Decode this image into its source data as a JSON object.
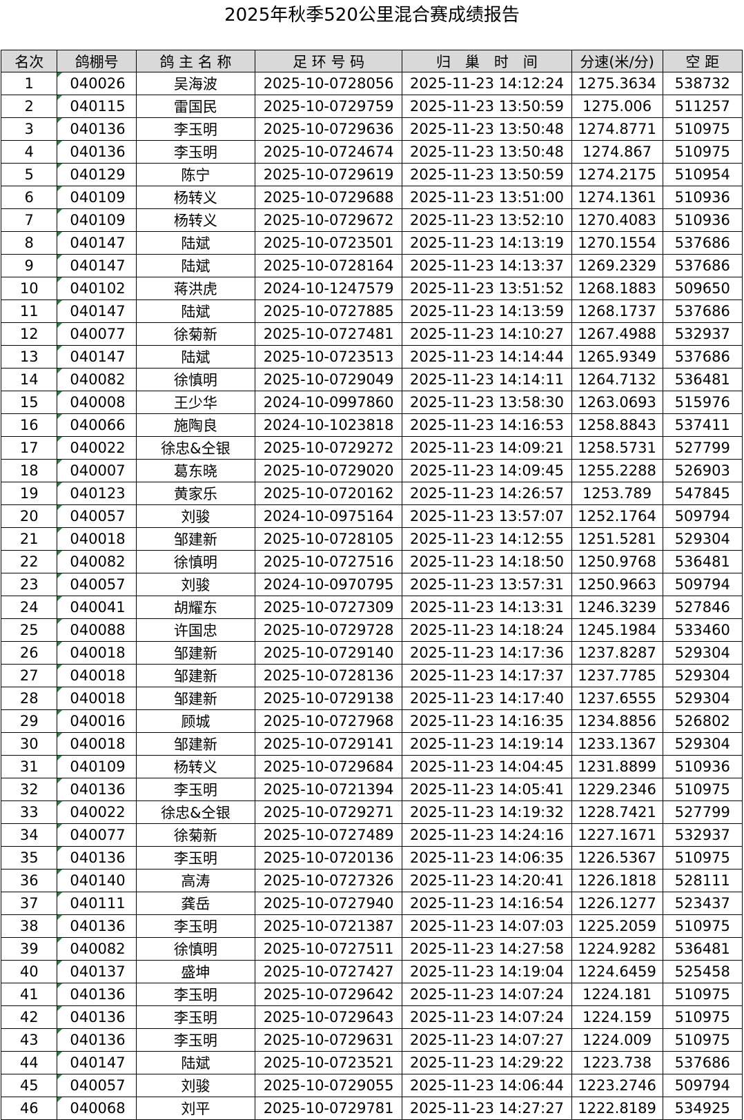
{
  "title": "2025年秋季520公里混合赛成绩报告",
  "columns": [
    "名次",
    "鸽棚号",
    "鸽 主 名 称",
    "足 环 号 码",
    "归　巢　时　间",
    "分速(米/分)",
    "空 距"
  ],
  "rows": [
    [
      "1",
      "040026",
      "吴海波",
      "2025-10-0728056",
      "2025-11-23 14:12:24",
      "1275.3634",
      "538732"
    ],
    [
      "2",
      "040115",
      "雷国民",
      "2025-10-0729759",
      "2025-11-23 13:50:59",
      "1275.006",
      "511257"
    ],
    [
      "3",
      "040136",
      "李玉明",
      "2025-10-0729636",
      "2025-11-23 13:50:48",
      "1274.8771",
      "510975"
    ],
    [
      "4",
      "040136",
      "李玉明",
      "2025-10-0724674",
      "2025-11-23 13:50:48",
      "1274.867",
      "510975"
    ],
    [
      "5",
      "040129",
      "陈宁",
      "2025-10-0729619",
      "2025-11-23 13:50:59",
      "1274.2175",
      "510954"
    ],
    [
      "6",
      "040109",
      "杨转义",
      "2025-10-0729688",
      "2025-11-23 13:51:00",
      "1274.1361",
      "510936"
    ],
    [
      "7",
      "040109",
      "杨转义",
      "2025-10-0729672",
      "2025-11-23 13:52:10",
      "1270.4083",
      "510936"
    ],
    [
      "8",
      "040147",
      "陆斌",
      "2025-10-0723501",
      "2025-11-23 14:13:19",
      "1270.1554",
      "537686"
    ],
    [
      "9",
      "040147",
      "陆斌",
      "2025-10-0728164",
      "2025-11-23 14:13:37",
      "1269.2329",
      "537686"
    ],
    [
      "10",
      "040102",
      "蒋洪虎",
      "2024-10-1247579",
      "2025-11-23 13:51:52",
      "1268.1883",
      "509650"
    ],
    [
      "11",
      "040147",
      "陆斌",
      "2025-10-0727885",
      "2025-11-23 14:13:59",
      "1268.1737",
      "537686"
    ],
    [
      "12",
      "040077",
      "徐菊新",
      "2025-10-0727481",
      "2025-11-23 14:10:27",
      "1267.4988",
      "532937"
    ],
    [
      "13",
      "040147",
      "陆斌",
      "2025-10-0723513",
      "2025-11-23 14:14:44",
      "1265.9349",
      "537686"
    ],
    [
      "14",
      "040082",
      "徐慎明",
      "2025-10-0729049",
      "2025-11-23 14:14:11",
      "1264.7132",
      "536481"
    ],
    [
      "15",
      "040008",
      "王少华",
      "2024-10-0997860",
      "2025-11-23 13:58:30",
      "1263.0693",
      "515976"
    ],
    [
      "16",
      "040066",
      "施陶良",
      "2024-10-1023818",
      "2025-11-23 14:16:53",
      "1258.8843",
      "537411"
    ],
    [
      "17",
      "040022",
      "徐忠&仝银",
      "2025-10-0729272",
      "2025-11-23 14:09:21",
      "1258.5731",
      "527799"
    ],
    [
      "18",
      "040007",
      "葛东晓",
      "2025-10-0729020",
      "2025-11-23 14:09:45",
      "1255.2288",
      "526903"
    ],
    [
      "19",
      "040123",
      "黄家乐",
      "2025-10-0720162",
      "2025-11-23 14:26:57",
      "1253.789",
      "547845"
    ],
    [
      "20",
      "040057",
      "刘骏",
      "2024-10-0975164",
      "2025-11-23 13:57:07",
      "1252.1764",
      "509794"
    ],
    [
      "21",
      "040018",
      "邹建新",
      "2025-10-0728105",
      "2025-11-23 14:12:55",
      "1251.5281",
      "529304"
    ],
    [
      "22",
      "040082",
      "徐慎明",
      "2025-10-0727516",
      "2025-11-23 14:18:50",
      "1250.9768",
      "536481"
    ],
    [
      "23",
      "040057",
      "刘骏",
      "2024-10-0970795",
      "2025-11-23 13:57:31",
      "1250.9663",
      "509794"
    ],
    [
      "24",
      "040041",
      "胡耀东",
      "2025-10-0727309",
      "2025-11-23 14:13:31",
      "1246.3239",
      "527846"
    ],
    [
      "25",
      "040088",
      "许国忠",
      "2025-10-0729728",
      "2025-11-23 14:18:24",
      "1245.1984",
      "533460"
    ],
    [
      "26",
      "040018",
      "邹建新",
      "2025-10-0729140",
      "2025-11-23 14:17:36",
      "1237.8287",
      "529304"
    ],
    [
      "27",
      "040018",
      "邹建新",
      "2025-10-0728136",
      "2025-11-23 14:17:37",
      "1237.7785",
      "529304"
    ],
    [
      "28",
      "040018",
      "邹建新",
      "2025-10-0729138",
      "2025-11-23 14:17:40",
      "1237.6555",
      "529304"
    ],
    [
      "29",
      "040016",
      "顾城",
      "2025-10-0727968",
      "2025-11-23 14:16:35",
      "1234.8856",
      "526802"
    ],
    [
      "30",
      "040018",
      "邹建新",
      "2025-10-0729141",
      "2025-11-23 14:19:14",
      "1233.1367",
      "529304"
    ],
    [
      "31",
      "040109",
      "杨转义",
      "2025-10-0729684",
      "2025-11-23 14:04:45",
      "1231.8899",
      "510936"
    ],
    [
      "32",
      "040136",
      "李玉明",
      "2025-10-0721394",
      "2025-11-23 14:05:41",
      "1229.2346",
      "510975"
    ],
    [
      "33",
      "040022",
      "徐忠&仝银",
      "2025-10-0729271",
      "2025-11-23 14:19:32",
      "1228.7421",
      "527799"
    ],
    [
      "34",
      "040077",
      "徐菊新",
      "2025-10-0727489",
      "2025-11-23 14:24:16",
      "1227.1671",
      "532937"
    ],
    [
      "35",
      "040136",
      "李玉明",
      "2025-10-0720136",
      "2025-11-23 14:06:35",
      "1226.5367",
      "510975"
    ],
    [
      "36",
      "040140",
      "高涛",
      "2025-10-0727326",
      "2025-11-23 14:20:41",
      "1226.1818",
      "528111"
    ],
    [
      "37",
      "040111",
      "龚岳",
      "2025-10-0727940",
      "2025-11-23 14:16:54",
      "1226.1277",
      "523437"
    ],
    [
      "38",
      "040136",
      "李玉明",
      "2025-10-0721387",
      "2025-11-23 14:07:03",
      "1225.2059",
      "510975"
    ],
    [
      "39",
      "040082",
      "徐慎明",
      "2025-10-0727511",
      "2025-11-23 14:27:58",
      "1224.9282",
      "536481"
    ],
    [
      "40",
      "040137",
      "盛坤",
      "2025-10-0727427",
      "2025-11-23 14:19:04",
      "1224.6459",
      "525458"
    ],
    [
      "41",
      "040136",
      "李玉明",
      "2025-10-0729642",
      "2025-11-23 14:07:24",
      "1224.181",
      "510975"
    ],
    [
      "42",
      "040136",
      "李玉明",
      "2025-10-0729643",
      "2025-11-23 14:07:24",
      "1224.159",
      "510975"
    ],
    [
      "43",
      "040136",
      "李玉明",
      "2025-10-0729631",
      "2025-11-23 14:07:27",
      "1224.009",
      "510975"
    ],
    [
      "44",
      "040147",
      "陆斌",
      "2025-10-0723521",
      "2025-11-23 14:29:22",
      "1223.738",
      "537686"
    ],
    [
      "45",
      "040057",
      "刘骏",
      "2025-10-0729055",
      "2025-11-23 14:06:44",
      "1223.2746",
      "509794"
    ],
    [
      "46",
      "040068",
      "刘平",
      "2025-10-0729781",
      "2025-11-23 14:27:27",
      "1222.8189",
      "534925"
    ]
  ],
  "marker_color": "#1e8a3a"
}
